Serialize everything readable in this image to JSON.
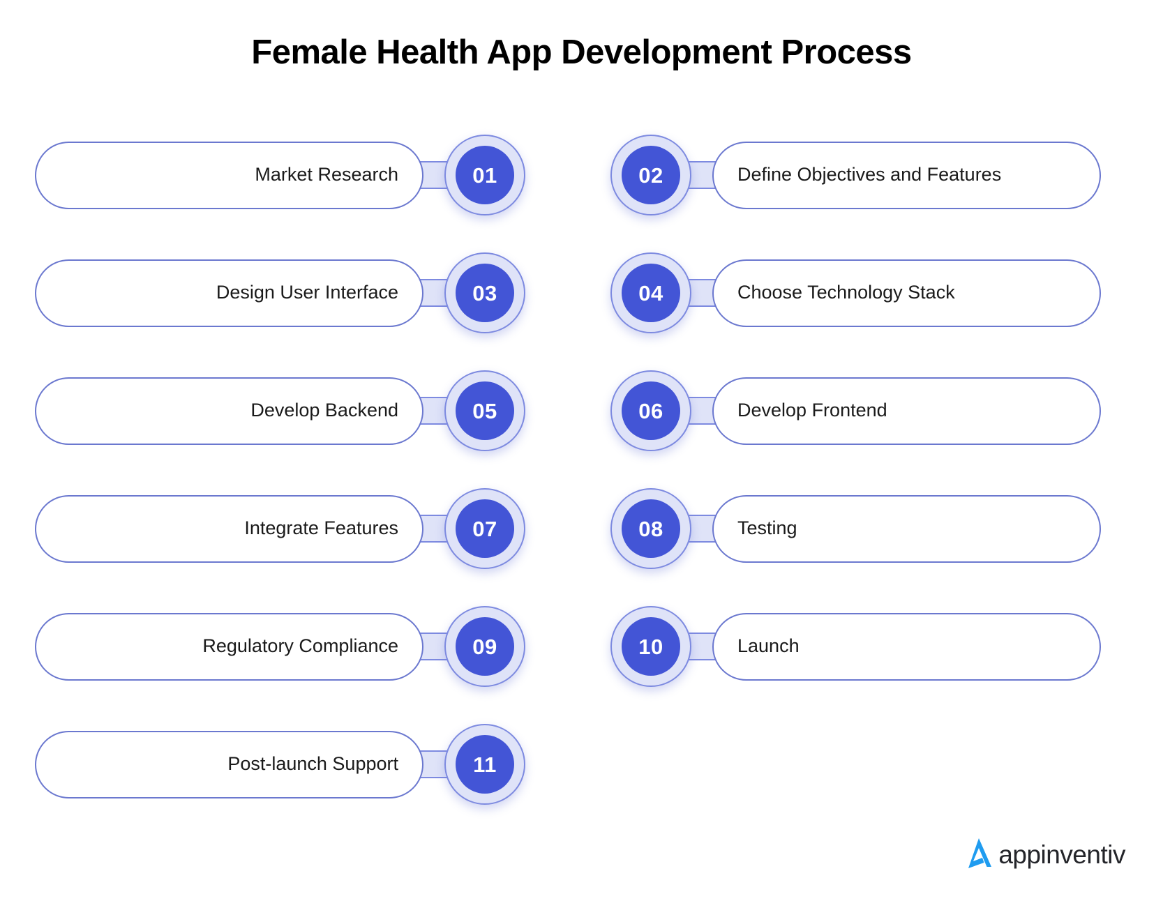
{
  "page": {
    "title": "Female Health App Development Process",
    "background_color": "#ffffff"
  },
  "theme": {
    "badge_fill": "#4355d6",
    "badge_ring": "#dfe3f8",
    "badge_border": "#7d8ae0",
    "pill_border": "#6b78cf",
    "pill_fill": "#ffffff",
    "text_color": "#1a1a1a",
    "title_color": "#000000",
    "logo_accent": "#1f9cf0"
  },
  "rows": [
    {
      "left": {
        "number": "01",
        "label": "Market Research"
      },
      "right": {
        "number": "02",
        "label": "Define Objectives and Features"
      }
    },
    {
      "left": {
        "number": "03",
        "label": "Design User Interface"
      },
      "right": {
        "number": "04",
        "label": "Choose Technology Stack"
      }
    },
    {
      "left": {
        "number": "05",
        "label": "Develop Backend"
      },
      "right": {
        "number": "06",
        "label": "Develop Frontend"
      }
    },
    {
      "left": {
        "number": "07",
        "label": "Integrate Features"
      },
      "right": {
        "number": "08",
        "label": "Testing"
      }
    },
    {
      "left": {
        "number": "09",
        "label": "Regulatory Compliance"
      },
      "right": {
        "number": "10",
        "label": "Launch"
      }
    },
    {
      "left": {
        "number": "11",
        "label": "Post-launch Support"
      },
      "right": null
    }
  ],
  "logo": {
    "text": "appinventiv",
    "mark_name": "appinventiv-arrow-mark"
  }
}
